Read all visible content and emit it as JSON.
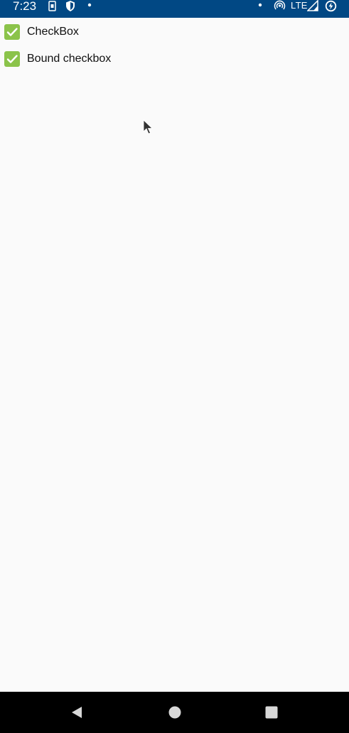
{
  "status_bar": {
    "time": "7:23",
    "network": "LTE",
    "background_color": "#014884",
    "icons": [
      "sim-card-icon",
      "shield-icon",
      "notification-dot-icon",
      "notification-dot-icon",
      "hotspot-icon",
      "signal-icon",
      "battery-charging-icon"
    ]
  },
  "checkboxes": [
    {
      "label": "CheckBox",
      "checked": true
    },
    {
      "label": "Bound checkbox",
      "checked": true
    }
  ],
  "accent_color": "#8bc34a",
  "navigation_bar": {
    "buttons": [
      "back-icon",
      "home-icon",
      "recents-icon"
    ]
  }
}
